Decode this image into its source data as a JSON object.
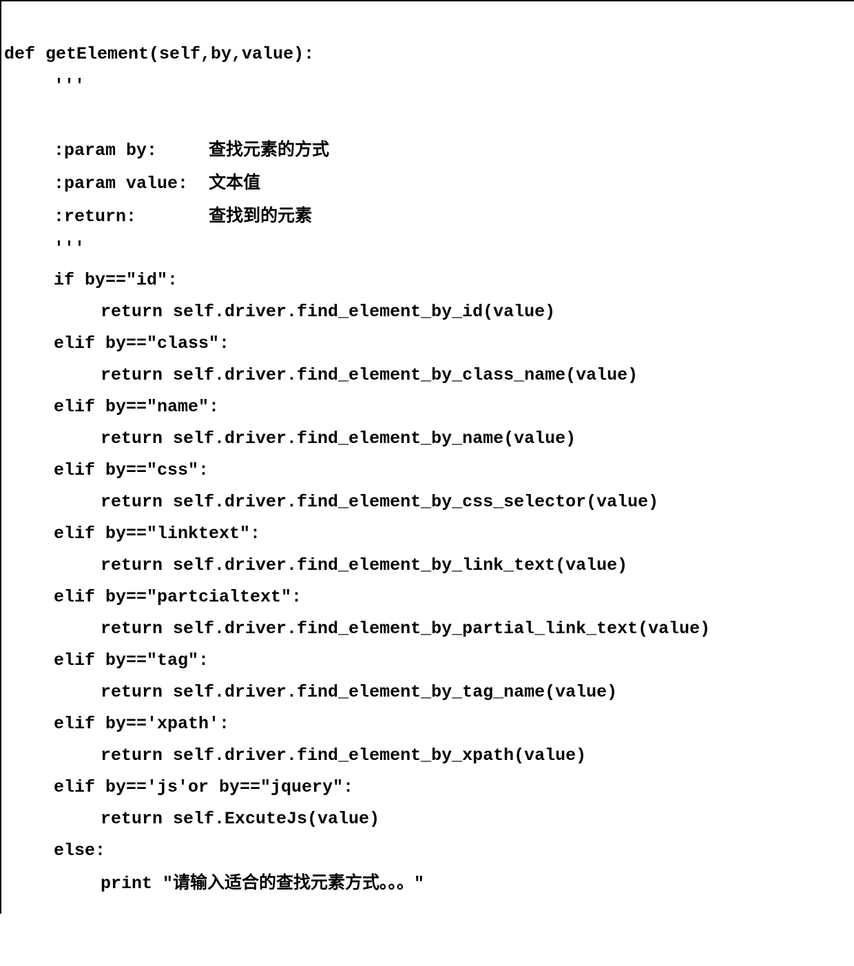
{
  "code": {
    "line1": "def getElement(self,by,value):",
    "line2": "'''",
    "line3": "",
    "line4_a": ":param by:",
    "line4_b": "查找元素的方式",
    "line5_a": ":param value:",
    "line5_b": "文本值",
    "line6_a": ":return:",
    "line6_b": "查找到的元素",
    "line7": "'''",
    "line8": "if by==\"id\":",
    "line9": "return self.driver.find_element_by_id(value)",
    "line10": "elif by==\"class\":",
    "line11": "return self.driver.find_element_by_class_name(value)",
    "line12": "elif by==\"name\":",
    "line13": "return self.driver.find_element_by_name(value)",
    "line14": "elif by==\"css\":",
    "line15": "return self.driver.find_element_by_css_selector(value)",
    "line16": "elif by==\"linktext\":",
    "line17": "return self.driver.find_element_by_link_text(value)",
    "line18": "elif by==\"partcialtext\":",
    "line19": "return self.driver.find_element_by_partial_link_text(value)",
    "line20": "elif by==\"tag\":",
    "line21": "return self.driver.find_element_by_tag_name(value)",
    "line22": "elif by=='xpath':",
    "line23": "return self.driver.find_element_by_xpath(value)",
    "line24": "elif by=='js'or by==\"jquery\":",
    "line25": "return self.ExcuteJs(value)",
    "line26": "else:",
    "line27_a": "print \"",
    "line27_b": "请输入适合的查找元素方式。。。",
    "line27_c": "\""
  }
}
